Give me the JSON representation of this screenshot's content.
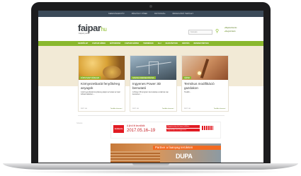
{
  "topnav": {
    "items": [
      "KERESŐ&ARCHÍV",
      "PÉNZÜGYI HÍREK",
      "BIZTONSÁG",
      "ÉRDEKLŐDŐ TERÜLET"
    ]
  },
  "header": {
    "logo_main": "faipar",
    "logo_suffix": "hu",
    "tagline": "Faipari portál",
    "search_placeholder": "Keresés",
    "links": [
      "Bejelentkezés",
      "Regisztráció"
    ]
  },
  "nav": {
    "items": [
      "KEZDŐLAP",
      "FAIPARI HÍREK",
      "BÚTORIPAR",
      "FAIPARI GÉPEK",
      "TERMÉKEK",
      "ALJ",
      "KIADVÁNYOK",
      "KÉPZÉS",
      "RENDEZVÉNYEK"
    ]
  },
  "cards": [
    {
      "tag": "KÖRNYEZETVÉDELEM",
      "title": "Környezetbarát fenyőkéreg anyagok",
      "text": "A környezetbarát fenyőkéreg alapú termékek az ipari felhasználásban ...",
      "date": "2017. 04.",
      "more": "Tovább olvasom ›"
    },
    {
      "tag": "SZAKMAI RENDEZVÉNYEK",
      "title": "Ingyenes Power 3D bemutató",
      "text": "A Power 3D program bemutatója a szakmai nap keretében ...",
      "date": "2017. 04.",
      "more": "Tovább olvasom ›"
    },
    {
      "tag": "GÉPEK",
      "title": "Termikus modifikáció gazdakon",
      "text": "Tovább...",
      "date": "2017. 04.",
      "more": "Tovább olvasom ›"
    }
  ],
  "sidebar_note": "hirdetés",
  "ad1": {
    "logo": "Ambiente",
    "kicker": "A jövő itt kezdődik",
    "date": "2017.05.16–19",
    "line1": "Magyarország első faipari kiállítása",
    "line2": "Regisztráljon most ingyenesen"
  },
  "ad2": {
    "banner": "Partner a faanyag területen",
    "brand": "DUPA"
  }
}
